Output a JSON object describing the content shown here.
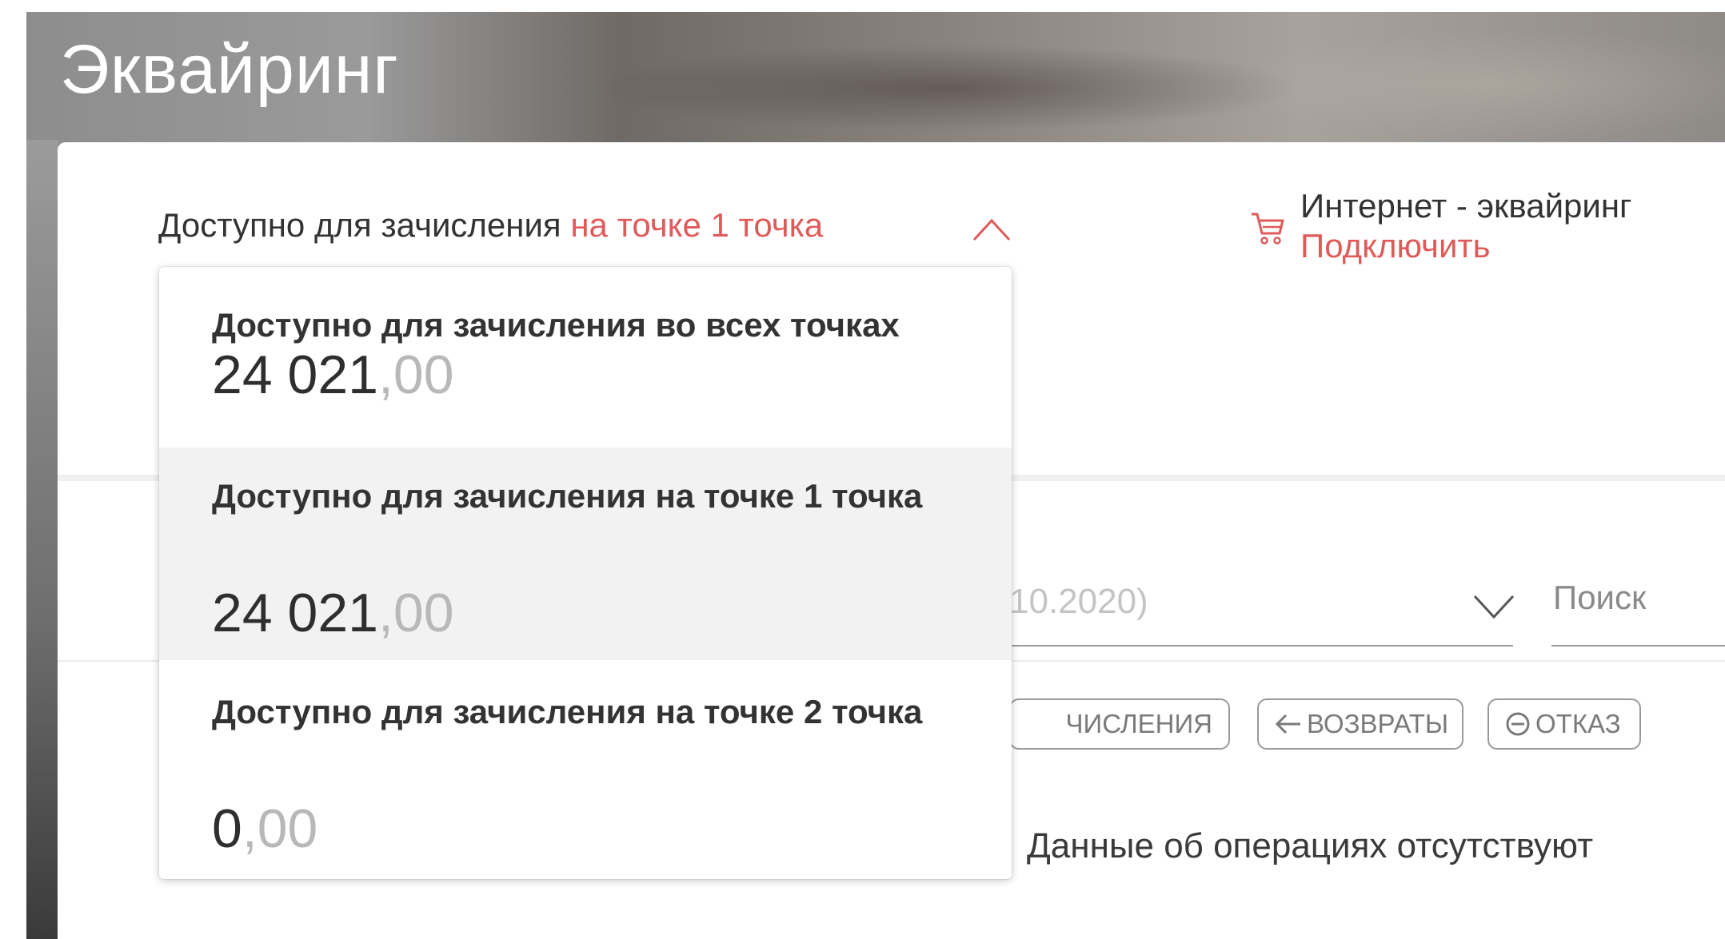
{
  "page": {
    "title": "Эквайринг"
  },
  "balance_selector": {
    "prefix": "Доступно для зачисления",
    "selected": "на точке 1 точка"
  },
  "internet_acquiring": {
    "title": "Интернет - эквайринг",
    "link": "Подключить"
  },
  "dropdown": {
    "items": [
      {
        "label": "Доступно для зачисления во всех точках",
        "amount_int": "24 021",
        "amount_frac": ",00",
        "selected": false
      },
      {
        "label": "Доступно для зачисления на точке 1 точка",
        "amount_int": "24 021",
        "amount_frac": ",00",
        "selected": true
      },
      {
        "label": "Доступно для зачисления на точке 2 точка",
        "amount_int": "0",
        "amount_frac": ",00",
        "selected": false
      }
    ]
  },
  "filters": {
    "period_value": "10.2020)",
    "search_placeholder": "Поиск",
    "chips": [
      {
        "label": "ЧИСЛЕНИЯ"
      },
      {
        "label": "ВОЗВРАТЫ",
        "icon": "arrow-left-icon"
      },
      {
        "label": "ОТКАЗ",
        "icon": "minus-circle-icon"
      }
    ]
  },
  "operations": {
    "empty_message": "Данные об операциях отсутствуют"
  },
  "colors": {
    "accent": "#e05a5a",
    "text": "#333333",
    "muted": "#b8b8b8"
  }
}
